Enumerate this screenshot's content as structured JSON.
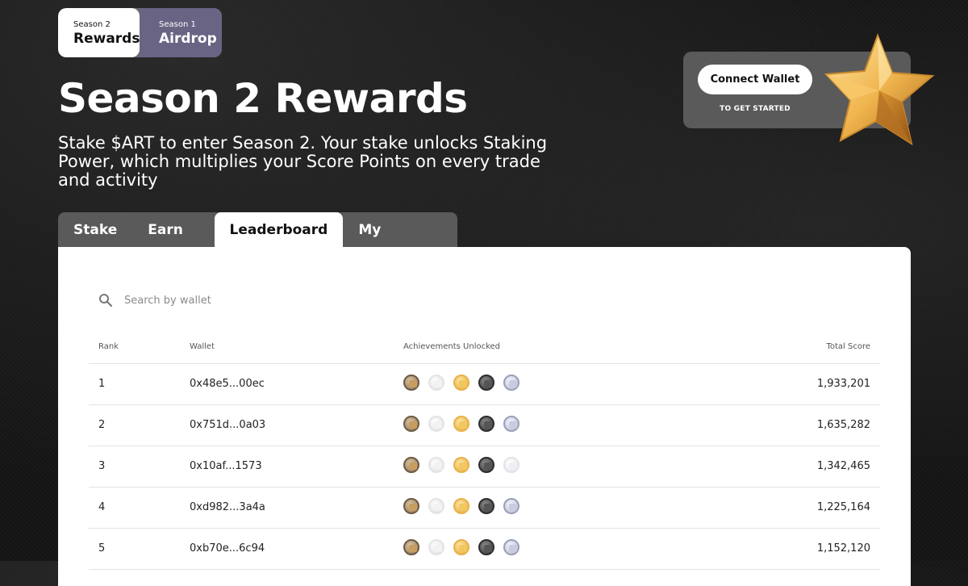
{
  "season_toggle": {
    "active": {
      "small": "Season 2",
      "big": "Rewards"
    },
    "inactive": {
      "small": "Season 1",
      "big": "Airdrop"
    }
  },
  "page_title": "Season 2 Rewards",
  "subtitle": "Stake $ART to enter Season 2. Your stake unlocks Staking Power, which multiplies your Score Points on every trade and activity",
  "connect": {
    "button": "Connect Wallet",
    "sub": "TO GET STARTED"
  },
  "tabs": [
    {
      "label": "Stake"
    },
    {
      "label": "Earn Score"
    },
    {
      "label": "Leaderboard",
      "active": true
    },
    {
      "label": "My Dashboard"
    }
  ],
  "search": {
    "placeholder": "Search by wallet"
  },
  "table": {
    "headers": {
      "rank": "Rank",
      "wallet": "Wallet",
      "achievements": "Achievements Unlocked",
      "score": "Total Score"
    },
    "rows": [
      {
        "rank": "1",
        "wallet": "0x48e5...00ec",
        "score": "1,933,201",
        "badges": [
          "bronze",
          "white",
          "gold",
          "dark",
          "silver"
        ]
      },
      {
        "rank": "2",
        "wallet": "0x751d...0a03",
        "score": "1,635,282",
        "badges": [
          "bronze",
          "white",
          "gold",
          "dark",
          "silver"
        ]
      },
      {
        "rank": "3",
        "wallet": "0x10af...1573",
        "score": "1,342,465",
        "badges": [
          "bronze",
          "white",
          "gold",
          "dark",
          "silver-faded"
        ]
      },
      {
        "rank": "4",
        "wallet": "0xd982...3a4a",
        "score": "1,225,164",
        "badges": [
          "bronze",
          "white",
          "gold",
          "dark",
          "silver"
        ]
      },
      {
        "rank": "5",
        "wallet": "0xb70e...6c94",
        "score": "1,152,120",
        "badges": [
          "bronze",
          "white",
          "gold",
          "dark",
          "silver"
        ]
      }
    ]
  },
  "colors": {
    "accent_season1": "#6a6484",
    "panel": "#ffffff",
    "tab_bar": "#5a5a5a"
  }
}
